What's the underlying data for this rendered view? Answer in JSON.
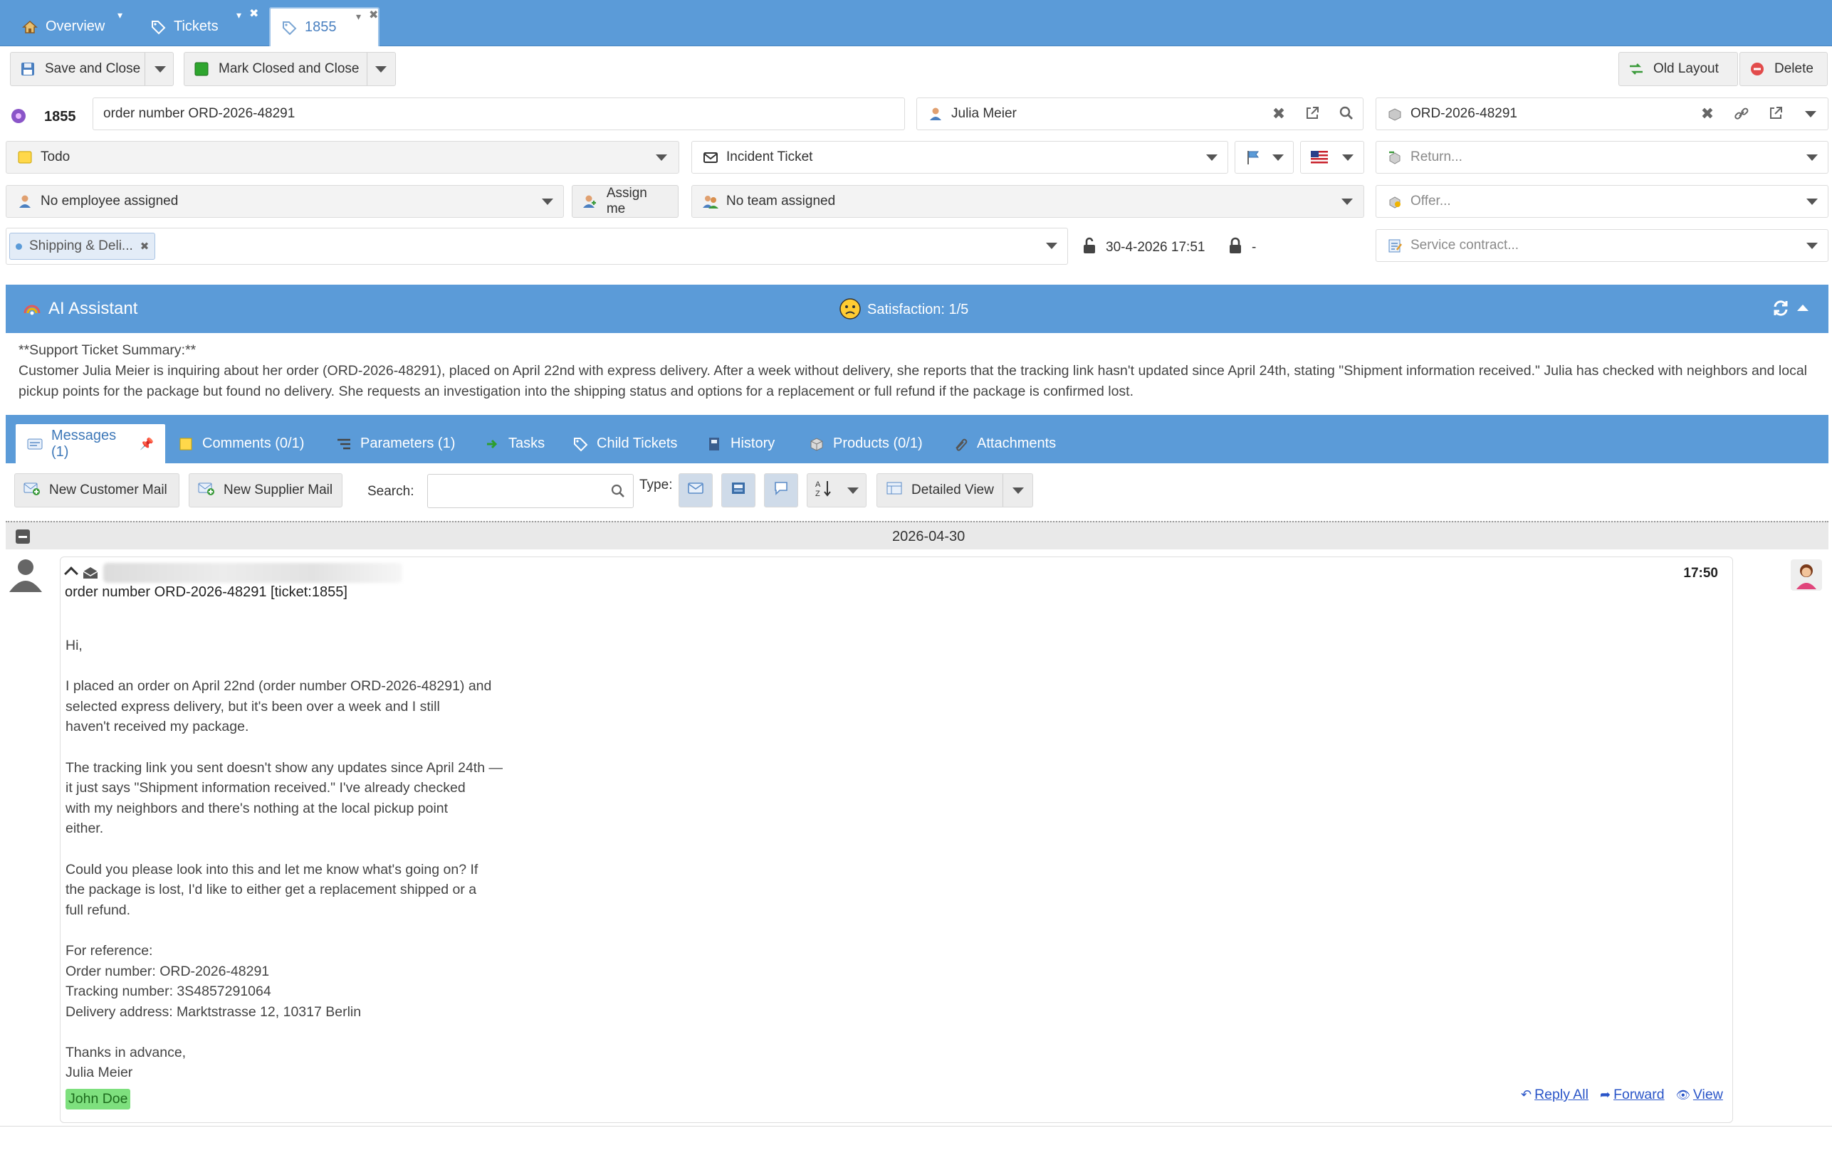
{
  "tabs": [
    {
      "label": "Overview",
      "icon": "home-icon"
    },
    {
      "label": "Tickets",
      "icon": "tag-icon"
    },
    {
      "label": "1855",
      "icon": "tag-icon",
      "active": true
    }
  ],
  "toolbar": {
    "save_close": "Save and Close",
    "mark_closed": "Mark Closed and Close",
    "old_layout": "Old Layout",
    "delete": "Delete"
  },
  "ticket": {
    "number": "1855",
    "subject": "order number ORD-2026-48291",
    "customer": "Julia Meier",
    "order": "ORD-2026-48291",
    "status": "Todo",
    "type": "Incident Ticket",
    "return_placeholder": "Return...",
    "employee": "No employee assigned",
    "assign_me": "Assign me",
    "team": "No team assigned",
    "offer_placeholder": "Offer...",
    "tag": "Shipping & Deli...",
    "created": "30-4-2026 17:51",
    "closed": "-",
    "service_contract_placeholder": "Service contract..."
  },
  "ai": {
    "title": "AI Assistant",
    "satisfaction": "Satisfaction: 1/5",
    "summary_heading": "**Support Ticket Summary:**",
    "summary_text": "Customer Julia Meier is inquiring about her order (ORD-2026-48291), placed on April 22nd with express delivery. After a week without delivery, she reports that the tracking link hasn't updated since April 24th, stating \"Shipment information received.\" Julia has checked with neighbors and local pickup points for the package but found no delivery. She requests an investigation into the shipping status and options for a replacement or full refund if the package is confirmed lost."
  },
  "subtabs": [
    {
      "label": "Messages (1)"
    },
    {
      "label": "Comments (0/1)"
    },
    {
      "label": "Parameters (1)"
    },
    {
      "label": "Tasks"
    },
    {
      "label": "Child Tickets"
    },
    {
      "label": "History"
    },
    {
      "label": "Products (0/1)"
    },
    {
      "label": "Attachments"
    }
  ],
  "messages_toolbar": {
    "new_customer_mail": "New Customer Mail",
    "new_supplier_mail": "New Supplier Mail",
    "search_label": "Search:",
    "search_value": "",
    "type_label": "Type:",
    "view": "Detailed View"
  },
  "group_date": "2026-04-30",
  "message": {
    "time": "17:50",
    "subject": "order number ORD-2026-48291 [ticket:1855]",
    "body_lines": [
      "Hi,",
      "",
      "I placed an order on April 22nd (order number ORD-2026-48291) and",
      "selected express delivery, but it's been over a week and I still",
      "haven't received my package.",
      "",
      "The tracking link you sent doesn't show any updates since April 24th —",
      "it just says \"Shipment information received.\" I've already checked",
      "with my neighbors and there's nothing at the local pickup point",
      "either.",
      "",
      "Could you please look into this and let me know what's going on? If",
      "the package is lost, I'd like to either get a replacement shipped or a",
      "full refund.",
      "",
      "For reference:",
      "Order number: ORD-2026-48291",
      "Tracking number: 3S4857291064",
      "Delivery address: Marktstrasse 12, 10317 Berlin",
      "",
      "Thanks in advance,",
      "Julia Meier"
    ],
    "agent_tag": "John Doe",
    "actions": {
      "reply_all": "Reply All",
      "forward": "Forward",
      "view": "View"
    }
  },
  "colors": {
    "accent": "#5b9bd8",
    "agent_tag": "#7ee07e",
    "link": "#2a55c8"
  }
}
